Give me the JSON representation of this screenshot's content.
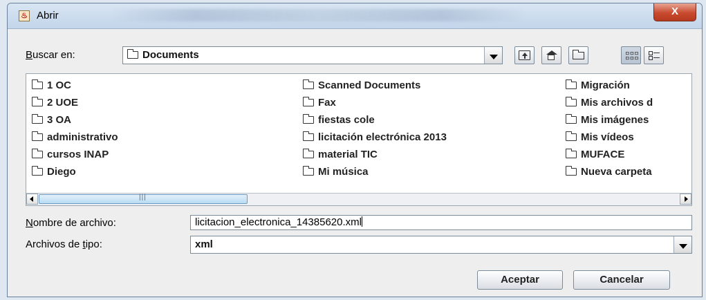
{
  "window": {
    "title": "Abrir",
    "close_label": "X"
  },
  "lookin": {
    "label_prefix": "",
    "label_accel": "B",
    "label_rest": "uscar en:",
    "value": "Documents"
  },
  "toolbar": {
    "buttons": [
      "up-folder",
      "home",
      "new-folder",
      "list-view",
      "details-view"
    ]
  },
  "files": {
    "columns": [
      [
        "1 OC",
        "2 UOE",
        "3 OA",
        "administrativo",
        "cursos INAP",
        "Diego"
      ],
      [
        "Scanned Documents",
        "Fax",
        "fiestas cole",
        "licitación electrónica 2013",
        "material TIC",
        "Mi música"
      ],
      [
        "Migración",
        "Mis archivos d",
        "Mis imágenes",
        "Mis vídeos",
        "MUFACE",
        "Nueva carpeta"
      ]
    ]
  },
  "filename": {
    "label_accel": "N",
    "label_rest": "ombre de archivo:",
    "value": "licitacion_electronica_14385620.xml"
  },
  "filetype": {
    "label_prefix": "Archivos de ",
    "label_accel": "t",
    "label_rest": "ipo:",
    "value": "xml"
  },
  "buttons": {
    "accept": "Aceptar",
    "cancel": "Cancelar"
  }
}
